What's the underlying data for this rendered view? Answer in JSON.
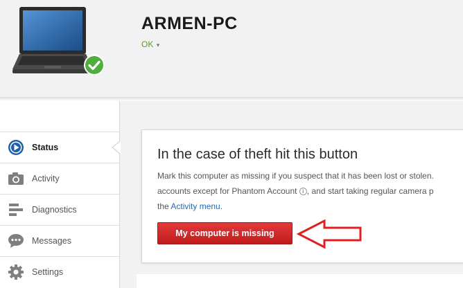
{
  "device": {
    "name": "ARMEN-PC",
    "status": "OK",
    "status_caret": "▾",
    "status_color": "#5aa02c",
    "image_icon": "laptop-icon",
    "badge_icon": "checkmark-icon"
  },
  "sidebar": {
    "items": [
      {
        "label": "Status",
        "icon": "play-icon",
        "active": true
      },
      {
        "label": "Activity",
        "icon": "camera-icon",
        "active": false
      },
      {
        "label": "Diagnostics",
        "icon": "bars-icon",
        "active": false
      },
      {
        "label": "Messages",
        "icon": "speech-bubble-icon",
        "active": false
      },
      {
        "label": "Settings",
        "icon": "gear-icon",
        "active": false
      }
    ]
  },
  "card": {
    "title": "In the case of theft hit this button",
    "line1": "Mark this computer as missing if you suspect that it has been lost or stolen.",
    "line2_a": "accounts except for Phantom Account",
    "line2_b": ", and start taking regular camera p",
    "line3_a": "the",
    "line3_link": "Activity menu",
    "line3_b": ".",
    "info_glyph": "i",
    "button_label": "My computer is missing",
    "button_color": "#d42a2a",
    "annotation": "red-arrow-icon"
  }
}
